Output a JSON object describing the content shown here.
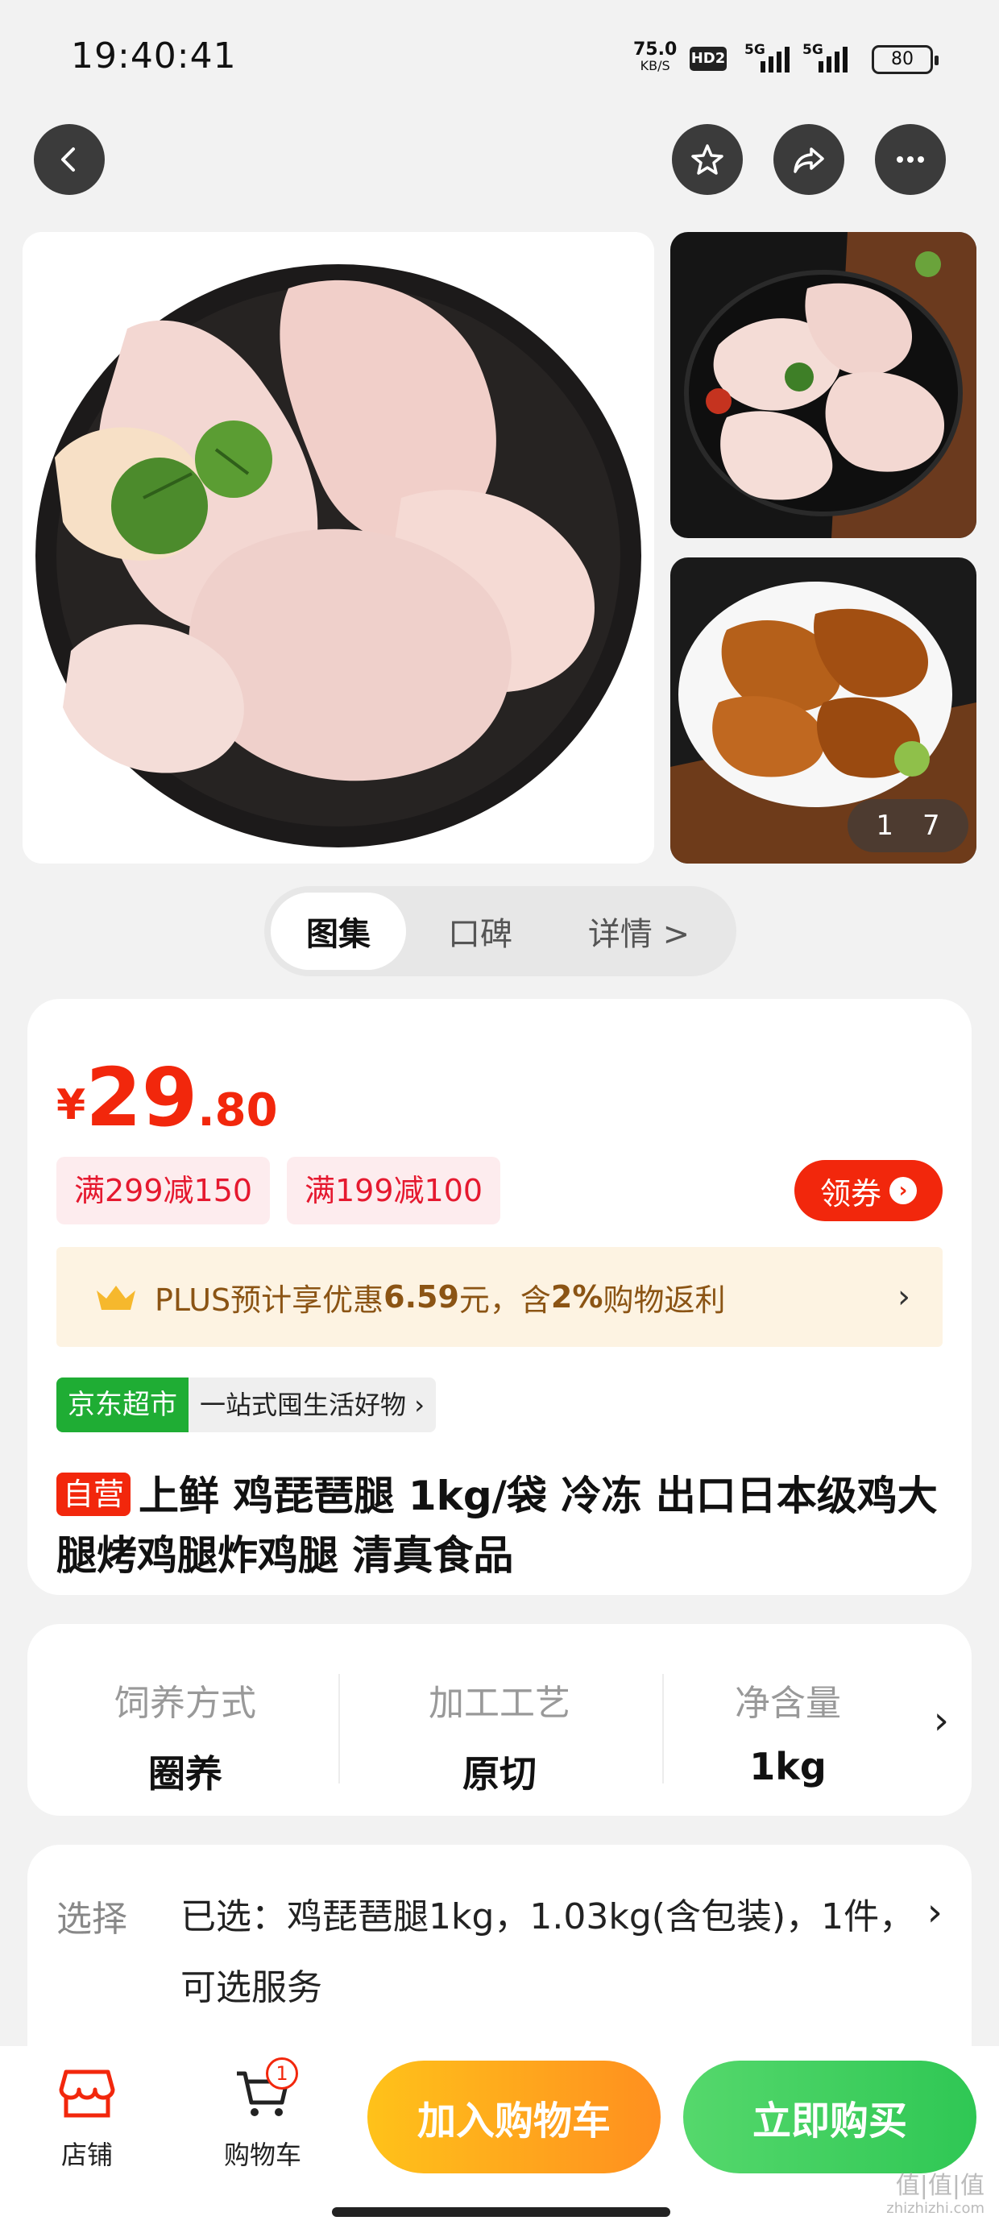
{
  "status_bar": {
    "time": "19:40:41",
    "net_speed": "75.0",
    "net_unit": "KB/S",
    "hd_label": "HD2",
    "sim1": "5G",
    "sim2": "5G",
    "battery": "80"
  },
  "nav": {
    "icons": [
      "back-icon",
      "star-icon",
      "share-icon",
      "more-icon"
    ]
  },
  "gallery": {
    "counter_current": "1",
    "counter_total": "7"
  },
  "tabs": {
    "items": [
      "图集",
      "口碑",
      "详情 >"
    ],
    "active": "图集"
  },
  "price": {
    "currency": "¥",
    "integer": "29",
    "decimal": ".80",
    "color": "#f2270c"
  },
  "coupons": [
    "满299减150",
    "满199减100"
  ],
  "get_coupon_label": "领券",
  "plus": {
    "prefix": "PLUS预计享优惠",
    "amount": "6.59",
    "mid": "元，含",
    "rate": "2%",
    "suffix": "购物返利"
  },
  "store_tag": {
    "badge": "京东超市",
    "slogan": "一站式囤生活好物",
    "chevron": "›"
  },
  "product": {
    "self_label": "自营",
    "title": "上鲜 鸡琵琶腿 1kg/袋 冷冻 出口日本级鸡大腿烤鸡腿炸鸡腿 清真食品"
  },
  "specs": [
    {
      "key": "饲养方式",
      "value": "圈养"
    },
    {
      "key": "加工工艺",
      "value": "原切"
    },
    {
      "key": "净含量",
      "value": "1kg"
    }
  ],
  "selection": {
    "label": "选择",
    "text": "已选：鸡琵琶腿1kg，1.03kg(含包装)，1件，可选服务"
  },
  "bottom_bar": {
    "store_label": "店铺",
    "cart_label": "购物车",
    "cart_badge": "1",
    "add_to_cart": "加入购物车",
    "buy_now": "立即购买"
  },
  "watermark": {
    "text": "值|值|值",
    "domain": "zhizhizhi.com"
  }
}
